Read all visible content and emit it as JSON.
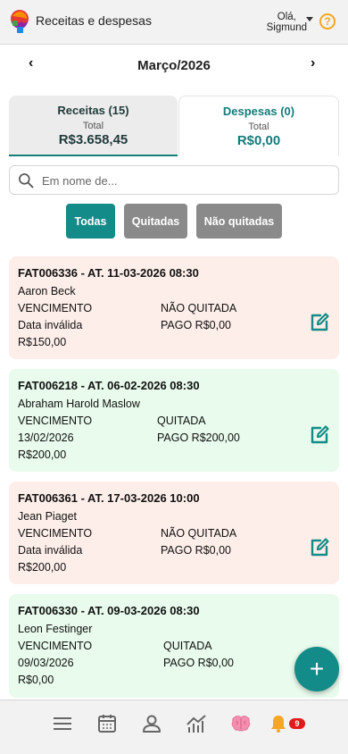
{
  "header": {
    "app_title": "Receitas e despesas",
    "greeting_line1": "Olá,",
    "greeting_line2": "Sigmund",
    "help_label": "?"
  },
  "month_nav": {
    "prev": "‹",
    "label": "Março/2026",
    "next": "›"
  },
  "tabs": [
    {
      "title": "Receitas (15)",
      "total_label": "Total",
      "total_value": "R$3.658,45",
      "active": true
    },
    {
      "title": "Despesas (0)",
      "total_label": "Total",
      "total_value": "R$0,00",
      "active": false
    }
  ],
  "search": {
    "placeholder": "Em nome de..."
  },
  "filters": {
    "all": "Todas",
    "paid": "Quitadas",
    "unpaid": "Não quitadas"
  },
  "items": [
    {
      "title": "FAT006336 - AT. 11-03-2026 08:30",
      "name": "Aaron Beck",
      "due_label": "VENCIMENTO",
      "due_date": "Data inválida",
      "amount": "R$150,00",
      "status": "NÃO QUITADA",
      "paid": "PAGO R$0,00",
      "state": "unpaid"
    },
    {
      "title": "FAT006218 - AT. 06-02-2026 08:30",
      "name": "Abraham Harold Maslow",
      "due_label": "VENCIMENTO",
      "due_date": "13/02/2026",
      "amount": "R$200,00",
      "status": "QUITADA",
      "paid": "PAGO R$200,00",
      "state": "paid"
    },
    {
      "title": "FAT006361 - AT. 17-03-2026 10:00",
      "name": "Jean Piaget",
      "due_label": "VENCIMENTO",
      "due_date": "Data inválida",
      "amount": "R$200,00",
      "status": "NÃO QUITADA",
      "paid": "PAGO R$0,00",
      "state": "unpaid"
    },
    {
      "title": "FAT006330 - AT. 09-03-2026 08:30",
      "name": "Leon Festinger",
      "due_label": "VENCIMENTO",
      "due_date": "09/03/2026",
      "amount": "R$0,00",
      "status": "QUITADA",
      "paid": "PAGO R$0,00",
      "state": "paid"
    }
  ],
  "fab_label": "+",
  "bottom_nav": {
    "icons": [
      "menu-icon",
      "calendar-icon",
      "user-icon",
      "chart-icon",
      "brain-icon",
      "bell-icon"
    ],
    "notification_count": "9"
  },
  "colors": {
    "accent": "#138b88",
    "unpaid_bg": "#fdeee9",
    "paid_bg": "#e8fbec",
    "filter_inactive": "#8a8a8a",
    "badge": "#e11b1b",
    "help": "#f5a623"
  }
}
